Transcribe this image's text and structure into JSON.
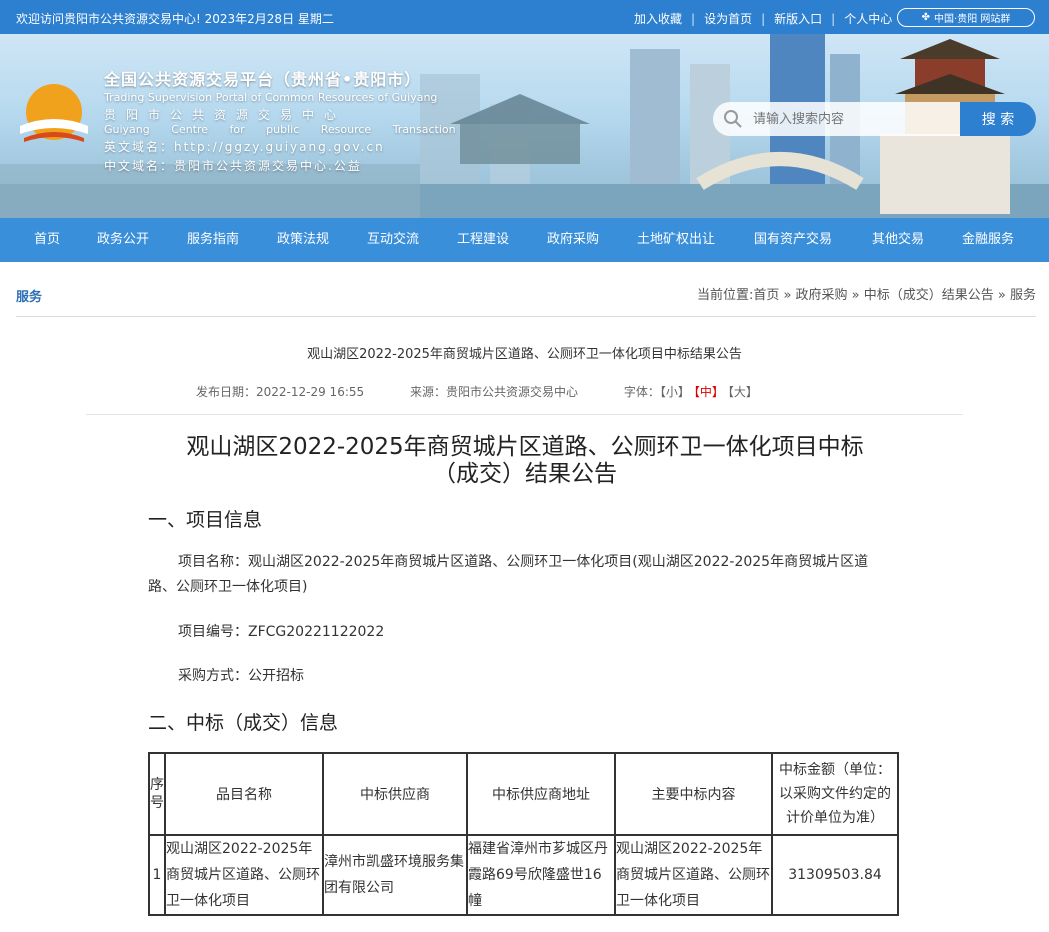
{
  "topbar": {
    "welcome": "欢迎访问贵阳市公共资源交易中心!  2023年2月28日 星期二",
    "links": [
      "加入收藏",
      "设为首页",
      "新版入口",
      "个人中心"
    ],
    "portal": "中国·贵阳 网站群"
  },
  "brand": {
    "line1": "全国公共资源交易平台（贵州省•贵阳市）",
    "line2": "Trading Supervision Portal of Common Resources of Guiyang",
    "line3": "贵阳市公共资源交易中心",
    "line4": "Guiyang Centre for public Resource Transaction",
    "line5": "英文域名：http://ggzy.guiyang.gov.cn",
    "line6": "中文域名：贵阳市公共资源交易中心.公益"
  },
  "search": {
    "placeholder": "请输入搜索内容",
    "button": "搜 索"
  },
  "nav": [
    "首页",
    "政务公开",
    "服务指南",
    "政策法规",
    "互动交流",
    "工程建设",
    "政府采购",
    "土地矿权出让",
    "国有资产交易",
    "其他交易",
    "金融服务"
  ],
  "section": "服务",
  "breadcrumb": "当前位置:首页 » 政府采购 » 中标（成交）结果公告 » 服务",
  "article": {
    "title": "观山湖区2022-2025年商贸城片区道路、公厕环卫一体化项目中标结果公告",
    "date": "发布日期：2022-12-29 16:55",
    "source": "来源：贵阳市公共资源交易中心",
    "font_label": "字体：",
    "font_small": "【小】",
    "font_mid": "【中】",
    "font_large": "【大】",
    "heading_line1": "观山湖区2022-2025年商贸城片区道路、公厕环卫一体化项目中标",
    "heading_line2": "（成交）结果公告",
    "sec1": "一、项目信息",
    "project_name": "项目名称：观山湖区2022-2025年商贸城片区道路、公厕环卫一体化项目(观山湖区2022-2025年商贸城片区道路、公厕环卫一体化项目)",
    "project_no": "项目编号：ZFCG20221122022",
    "method": "采购方式：公开招标",
    "sec2": "二、中标（成交）信息"
  },
  "table": {
    "headers": [
      "序号",
      "品目名称",
      "中标供应商",
      "中标供应商地址",
      "主要中标内容",
      "中标金额（单位：以采购文件约定的计价单位为准）"
    ],
    "rows": [
      [
        "1",
        "观山湖区2022-2025年商贸城片区道路、公厕环卫一体化项目",
        "漳州市凯盛环境服务集团有限公司",
        "福建省漳州市芗城区丹霞路69号欣隆盛世16幢",
        "观山湖区2022-2025年商贸城片区道路、公厕环卫一体化项目",
        "31309503.84"
      ]
    ]
  }
}
